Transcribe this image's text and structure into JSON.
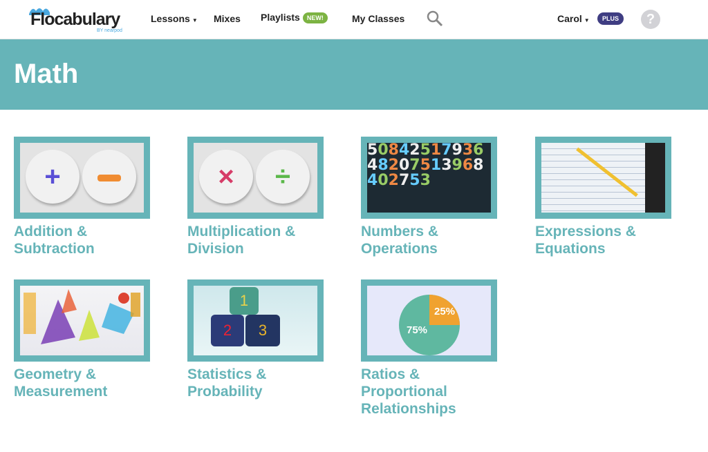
{
  "nav": {
    "logo": "Flocabulary",
    "logo_sub": "BY nearpod",
    "items": [
      {
        "label": "Lessons"
      },
      {
        "label": "Mixes"
      },
      {
        "label": "Playlists",
        "badge": "NEW!"
      },
      {
        "label": "My Classes"
      }
    ],
    "user": "Carol",
    "plan_badge": "PLUS",
    "help": "?"
  },
  "page_title": "Math",
  "categories": [
    {
      "title": "Addition & Subtraction"
    },
    {
      "title": "Multiplication & Division"
    },
    {
      "title": "Numbers & Operations"
    },
    {
      "title": "Expressions & Equations"
    },
    {
      "title": "Geometry & Measurement"
    },
    {
      "title": "Statistics & Probability"
    },
    {
      "title": "Ratios & Proportional Relationships",
      "pie_labels": [
        "25%",
        "75%"
      ]
    }
  ],
  "colors": {
    "accent": "#66b4b8",
    "plus_badge": "#3f3d82",
    "new_badge": "#7cb342"
  }
}
